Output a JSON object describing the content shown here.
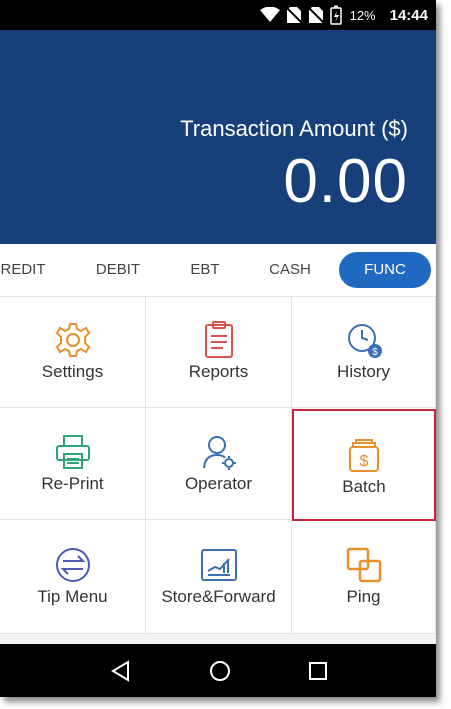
{
  "status_bar": {
    "battery_percent": "12%",
    "time": "14:44"
  },
  "amount": {
    "label": "Transaction Amount ($)",
    "value": "0.00"
  },
  "tabs": [
    {
      "label": "REDIT",
      "active": false
    },
    {
      "label": "DEBIT",
      "active": false
    },
    {
      "label": "EBT",
      "active": false
    },
    {
      "label": "CASH",
      "active": false
    },
    {
      "label": "FUNC",
      "active": true
    }
  ],
  "functions": [
    {
      "label": "Settings",
      "icon": "gear-icon",
      "color": "#e8902c"
    },
    {
      "label": "Reports",
      "icon": "clipboard-icon",
      "color": "#d9534f"
    },
    {
      "label": "History",
      "icon": "clock-dollar-icon",
      "color": "#3a6fb5"
    },
    {
      "label": "Re-Print",
      "icon": "printer-icon",
      "color": "#2ea37a"
    },
    {
      "label": "Operator",
      "icon": "user-gear-icon",
      "color": "#3a6fb5"
    },
    {
      "label": "Batch",
      "icon": "dollar-batch-icon",
      "color": "#e8902c",
      "selected": true
    },
    {
      "label": "Tip Menu",
      "icon": "exchange-arrows-icon",
      "color": "#4a5bb5"
    },
    {
      "label": "Store&Forward",
      "icon": "chart-board-icon",
      "color": "#3a6fb5"
    },
    {
      "label": "Ping",
      "icon": "overlap-squares-icon",
      "color": "#e8902c"
    }
  ],
  "colors": {
    "header_blue": "#17407a",
    "active_tab": "#1f69c0",
    "selected_border": "#c8233c"
  },
  "nav": {
    "back_icon": "back-triangle-icon",
    "home_icon": "home-circle-icon",
    "recents_icon": "recents-square-icon"
  }
}
